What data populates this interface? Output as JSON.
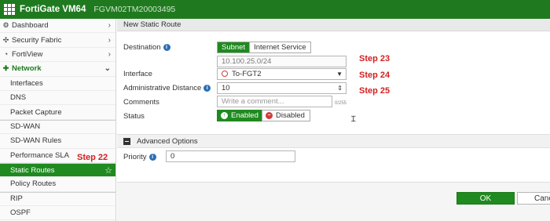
{
  "topbar": {
    "product": "FortiGate VM64",
    "serial": "FGVM02TM20003495",
    "color": "#1f7a1f"
  },
  "sidebar": {
    "items": [
      {
        "label": "Dashboard",
        "icon": "dashboard-icon",
        "glyph": "⚙",
        "chevron": "›"
      },
      {
        "label": "Security Fabric",
        "icon": "fabric-icon",
        "glyph": "✣",
        "chevron": "›"
      },
      {
        "label": "FortiView",
        "icon": "fortiview-icon",
        "glyph": "◔",
        "chevron": "›"
      },
      {
        "label": "Network",
        "icon": "network-icon",
        "glyph": "✚",
        "chevron": "⌄"
      },
      {
        "label": "Interfaces"
      },
      {
        "label": "DNS"
      },
      {
        "label": "Packet Capture"
      },
      {
        "label": "SD-WAN"
      },
      {
        "label": "SD-WAN Rules"
      },
      {
        "label": "Performance SLA"
      },
      {
        "label": "Static Routes",
        "star": "☆"
      },
      {
        "label": "Policy Routes"
      },
      {
        "label": "RIP"
      },
      {
        "label": "OSPF"
      }
    ]
  },
  "panel": {
    "title": "New Static Route",
    "destination": {
      "label": "Destination",
      "options": [
        "Subnet",
        "Internet Service"
      ],
      "selected": "Subnet",
      "value": "10.100.25.0/24"
    },
    "interface": {
      "label": "Interface",
      "value": "To-FGT2",
      "arrow": "▼"
    },
    "admin_distance": {
      "label": "Administrative Distance",
      "value": "10",
      "spinner": "⇕"
    },
    "comments": {
      "label": "Comments",
      "placeholder": "Write a comment...",
      "counter": "0/255"
    },
    "status": {
      "label": "Status",
      "enabled_label": "Enabled",
      "disabled_label": "Disabled",
      "enabled_glyph": "↑",
      "disabled_glyph": "−"
    },
    "advanced": {
      "label": "Advanced Options"
    },
    "priority": {
      "label": "Priority",
      "value": "0"
    },
    "info_glyph": "i"
  },
  "footer": {
    "ok_label": "OK",
    "cancel_label": "Cancel"
  },
  "annotations": {
    "step22": "Step 22",
    "step23": "Step 23",
    "step24": "Step 24",
    "step25": "Step 25",
    "color": "#d42020"
  }
}
